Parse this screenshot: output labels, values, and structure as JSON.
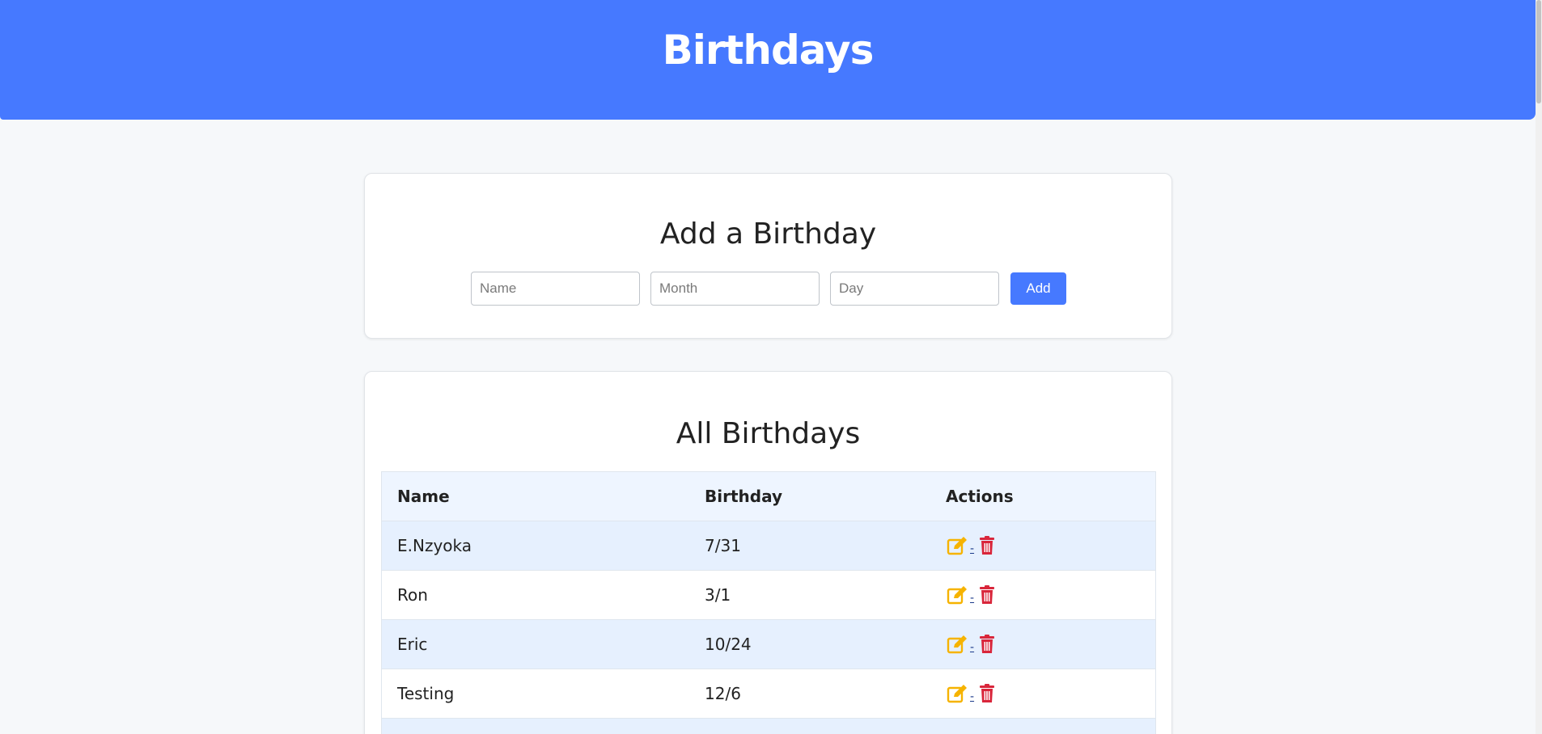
{
  "header": {
    "title": "Birthdays"
  },
  "add_form": {
    "title": "Add a Birthday",
    "name_placeholder": "Name",
    "month_placeholder": "Month",
    "day_placeholder": "Day",
    "add_label": "Add"
  },
  "list": {
    "title": "All Birthdays",
    "columns": [
      "Name",
      "Birthday",
      "Actions"
    ],
    "rows": [
      {
        "name": "E.Nzyoka",
        "birthday": "7/31"
      },
      {
        "name": "Ron",
        "birthday": "3/1"
      },
      {
        "name": "Eric",
        "birthday": "10/24"
      },
      {
        "name": "Testing",
        "birthday": "12/6"
      }
    ],
    "action_separator": "-"
  },
  "icons": {
    "edit": "edit-icon",
    "delete": "trash-icon"
  },
  "colors": {
    "accent": "#4679ff",
    "edit": "#f6b300",
    "delete": "#d9263b"
  }
}
